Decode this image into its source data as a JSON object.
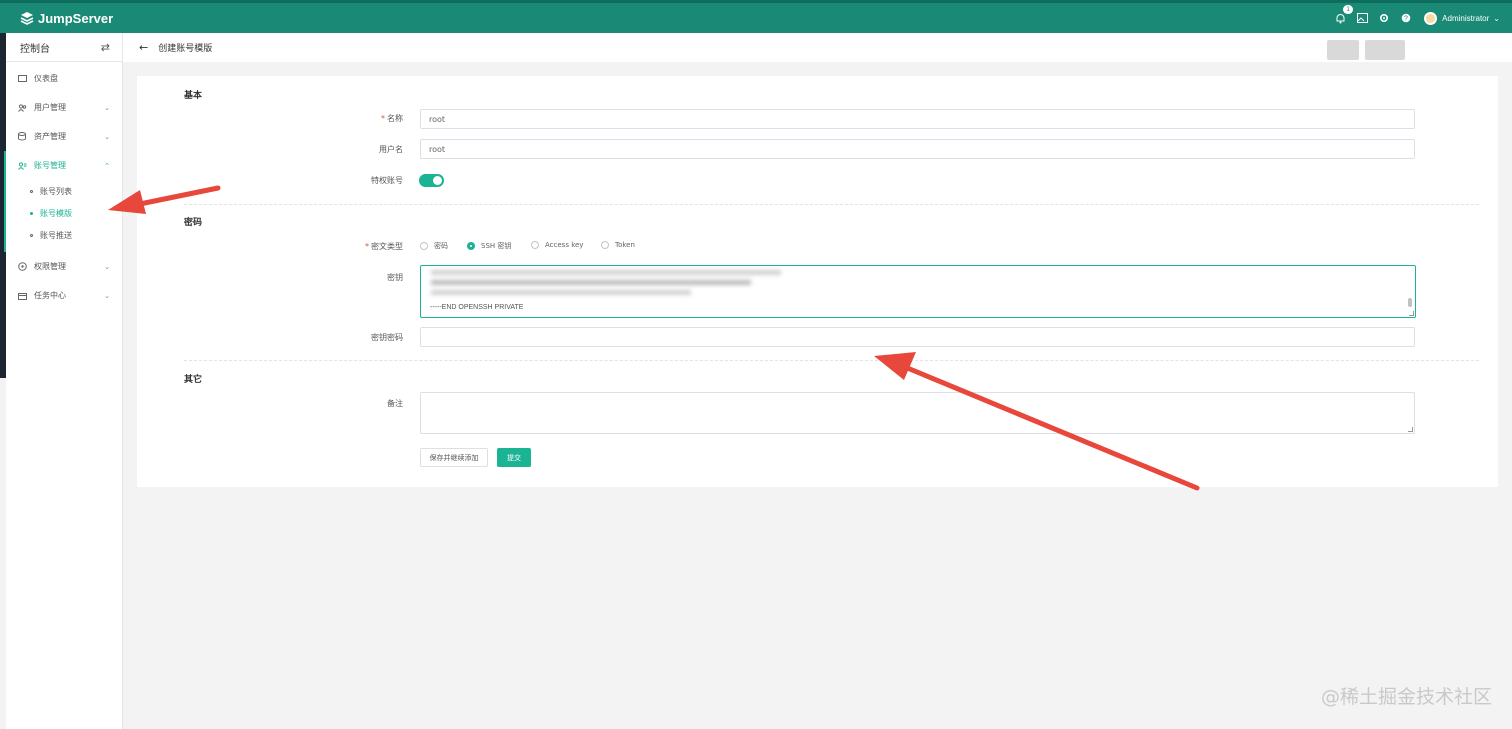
{
  "topbar": {
    "brand": "JumpServer",
    "notification_count": "1",
    "user_name": "Administrator",
    "icons": [
      "bell-icon",
      "image-icon",
      "gear-icon",
      "help-icon",
      "chevron-down-icon"
    ],
    "color": "#1a8a76"
  },
  "sidebar": {
    "title": "控制台",
    "items": [
      {
        "label": "仪表盘",
        "icon": "dashboard-icon"
      },
      {
        "label": "用户管理",
        "icon": "users-icon"
      },
      {
        "label": "资产管理",
        "icon": "assets-icon"
      },
      {
        "label": "账号管理",
        "icon": "accounts-icon",
        "active": true
      },
      {
        "label": "权限管理",
        "icon": "permission-icon"
      },
      {
        "label": "任务中心",
        "icon": "tasks-icon"
      }
    ],
    "account_sub": [
      {
        "label": "账号列表"
      },
      {
        "label": "账号模版",
        "active": true
      },
      {
        "label": "账号推送"
      }
    ]
  },
  "header": {
    "title": "创建账号模版"
  },
  "form": {
    "basic": {
      "title": "基本",
      "name_label": "名称",
      "name_value": "root",
      "username_label": "用户名",
      "username_value": "root",
      "privileged_label": "特权账号",
      "privileged_on": true
    },
    "secret": {
      "title": "密码",
      "type_label": "密文类型",
      "options": [
        "密码",
        "SSH 密钥",
        "Access key",
        "Token"
      ],
      "selected": "SSH 密钥",
      "key_label": "密钥",
      "key_tail": "-----END OPENSSH PRIVATE",
      "passphrase_label": "密钥密码"
    },
    "other": {
      "title": "其它",
      "comment_label": "备注"
    },
    "buttons": {
      "save_continue": "保存并继续添加",
      "submit": "提交"
    }
  },
  "watermark": "@稀土掘金技术社区",
  "accent": "#1ab394",
  "annotation_color": "#e8473c"
}
